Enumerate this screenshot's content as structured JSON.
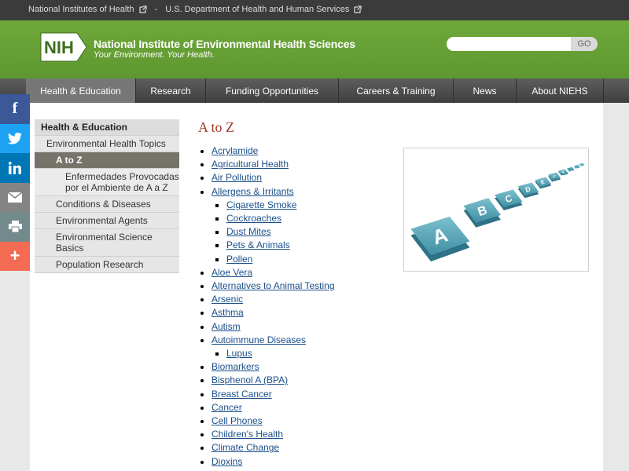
{
  "topbar": {
    "nih_link": "National Institutes of Health",
    "separator": "-",
    "hhs_link": "U.S. Department of Health and Human Services"
  },
  "banner": {
    "logo_text": "NIH",
    "org_name": "National Institute of Environmental Health Sciences",
    "tagline": "Your Environment. Your Health.",
    "search_placeholder": "",
    "search_button": "GO"
  },
  "nav": {
    "items": [
      {
        "label": "Health & Education"
      },
      {
        "label": "Research"
      },
      {
        "label": "Funding Opportunities"
      },
      {
        "label": "Careers & Training"
      },
      {
        "label": "News"
      },
      {
        "label": "About NIEHS"
      }
    ]
  },
  "share": {
    "facebook": "f",
    "plus": "+"
  },
  "leftnav": {
    "items": [
      {
        "label": "Health & Education"
      },
      {
        "label": "Environmental Health Topics"
      },
      {
        "label": "A to Z"
      },
      {
        "label": "Enfermedades Provocadas por el Ambiente de A a Z"
      },
      {
        "label": "Conditions & Diseases"
      },
      {
        "label": "Environmental Agents"
      },
      {
        "label": "Environmental Science Basics"
      },
      {
        "label": "Population Research"
      }
    ]
  },
  "main": {
    "title": "A to Z",
    "topics": [
      "Acrylamide",
      "Agricultural Health",
      "Air Pollution",
      "Allergens & Irritants",
      "Cigarette Smoke",
      "Cockroaches",
      "Dust Mites",
      "Pets & Animals",
      "Pollen",
      "Aloe Vera",
      "Alternatives to Animal Testing",
      "Arsenic",
      "Asthma",
      "Autism",
      "Autoimmune Diseases",
      "Lupus",
      "Biomarkers",
      "Bisphenol A (BPA)",
      "Breast Cancer",
      "Cancer",
      "Cell Phones",
      "Children's Health",
      "Climate Change",
      "Dioxins"
    ],
    "image_letters": [
      "A",
      "B",
      "C",
      "D",
      "E",
      "F",
      "G"
    ]
  },
  "colors": {
    "banner_green": "#6fa83a",
    "title_red": "#a03a27",
    "link_blue": "#1a4f8a",
    "facebook": "#3b5998",
    "twitter": "#1da1f2",
    "linkedin": "#0077b5",
    "email": "#848484",
    "print": "#738a8d",
    "more": "#f26b52"
  }
}
